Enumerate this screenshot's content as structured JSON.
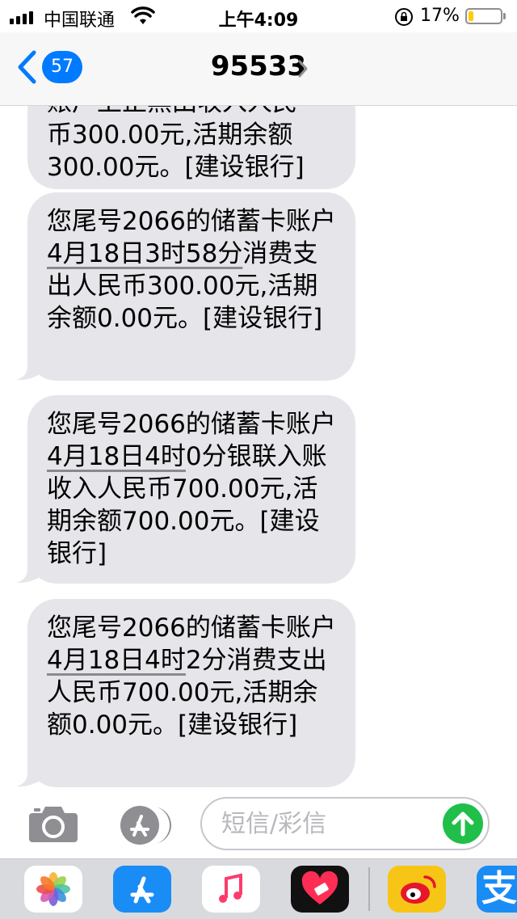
{
  "status_bar": {
    "carrier": "中国联通",
    "time": "上午4:09",
    "battery_percent": "17%",
    "battery_level": 0.17,
    "icons": [
      "signal-icon",
      "wifi-icon",
      "rotation-lock-icon",
      "battery-icon"
    ]
  },
  "nav": {
    "back_count": "57",
    "title": "95533",
    "accent_color": "#007aff"
  },
  "messages": [
    {
      "lines": [
        "账户上正黑田收入人民",
        "币300.00元,活期余额",
        "300.00元。[建设银行]"
      ]
    },
    {
      "pre": "您尾号2066的储蓄卡账户",
      "link": "4月18日3时58分",
      "post": "消费支出人民币300.00元,活期余额0.00元。[建设银行]"
    },
    {
      "pre": "您尾号2066的储蓄卡账户",
      "link": "4月18日4时",
      "post": "0分银联入账收入人民币700.00元,活期余额700.00元。[建设银行]"
    },
    {
      "pre": "您尾号2066的储蓄卡账户",
      "link": "4月18日4时",
      "post": "2分消费支出人民币700.00元,活期余额0.00元。[建设银行]"
    }
  ],
  "input": {
    "placeholder": "短信/彩信",
    "value": ""
  },
  "drawer": {
    "apps": [
      "photos-icon",
      "app-store-icon",
      "music-icon",
      "digital-touch-icon",
      "weibo-icon",
      "alipay-icon"
    ],
    "alipay_glyph": "支"
  },
  "colors": {
    "bubble": "#e5e5ea",
    "send": "#1fbf4a",
    "battery": "#ffcc00"
  }
}
